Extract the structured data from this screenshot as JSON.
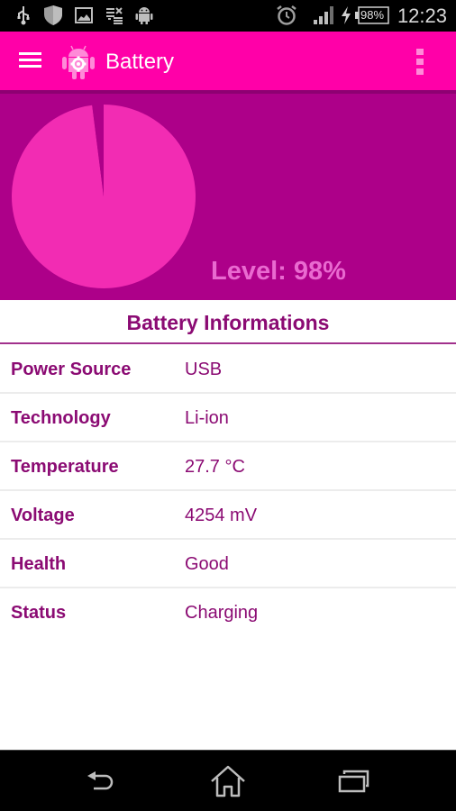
{
  "status_bar": {
    "left_icons": [
      "usb-icon",
      "shield-icon",
      "image-icon",
      "data-transfer-icon",
      "android-icon"
    ],
    "right_icons": [
      "alarm-icon",
      "signal-icon",
      "charging-bolt-icon",
      "battery-icon"
    ],
    "battery_percent": "98%",
    "time": "12:23"
  },
  "app_bar": {
    "menu_icon": "hamburger-menu-icon",
    "logo_icon": "android-gear-icon",
    "title": "Battery",
    "overflow_icon": "more-vert-icon"
  },
  "hero": {
    "level_label": "Level: 98%"
  },
  "chart_data": {
    "type": "pie",
    "title": "",
    "slices": [
      {
        "name": "charged",
        "value": 98,
        "color": "#f22cb3"
      },
      {
        "name": "empty",
        "value": 2,
        "color": "#ad0089"
      }
    ]
  },
  "info": {
    "title": "Battery Informations",
    "rows": [
      {
        "label": "Power Source",
        "value": "USB"
      },
      {
        "label": "Technology",
        "value": "Li-ion"
      },
      {
        "label": "Temperature",
        "value": "27.7 °C"
      },
      {
        "label": "Voltage",
        "value": "4254 mV"
      },
      {
        "label": "Health",
        "value": "Good"
      },
      {
        "label": "Status",
        "value": "Charging"
      }
    ]
  },
  "nav_bar": {
    "buttons": [
      "back-icon",
      "home-icon",
      "recents-icon"
    ]
  },
  "colors": {
    "accent": "#ff00a8",
    "hero_bg": "#ad0089",
    "pie_fill": "#f22cb3",
    "text_primary": "#8b0b73"
  }
}
